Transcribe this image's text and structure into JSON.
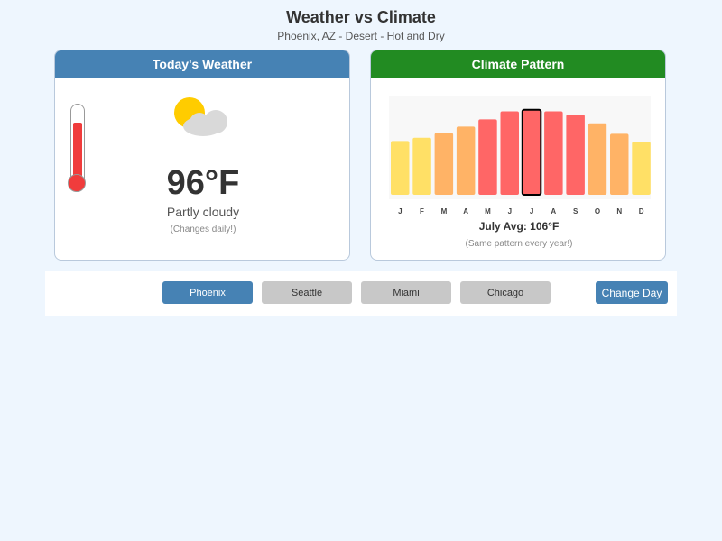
{
  "header": {
    "title": "Weather vs Climate",
    "subtitle": "Phoenix, AZ - Desert - Hot and Dry"
  },
  "weather_card": {
    "title": "Today's Weather",
    "temperature": "96°F",
    "condition": "Partly cloudy",
    "note": "(Changes daily!)",
    "icon": "partly-cloudy-icon",
    "thermometer_level": 0.78
  },
  "climate_card": {
    "title": "Climate Pattern",
    "caption": "July Avg: 106°F",
    "note": "(Same pattern every year!)"
  },
  "chart_data": {
    "type": "bar",
    "categories": [
      "J",
      "F",
      "M",
      "A",
      "M",
      "J",
      "J",
      "A",
      "S",
      "O",
      "N",
      "D"
    ],
    "values": [
      67,
      71,
      77,
      85,
      94,
      104,
      106,
      104,
      100,
      89,
      76,
      66
    ],
    "highlight_index": 6,
    "ylim": [
      0,
      115
    ],
    "grid": false
  },
  "colors": {
    "weather_header": "#4682b4",
    "climate_header": "#228b22",
    "bar_cool": "#ffe066",
    "bar_warm": "#ffb366",
    "bar_hot": "#ff6666",
    "thermometer": "#f03c3c",
    "sun": "#ffcc00",
    "cloud": "#d9d9d9"
  },
  "controls": {
    "cities": [
      {
        "label": "Phoenix",
        "active": true
      },
      {
        "label": "Seattle",
        "active": false
      },
      {
        "label": "Miami",
        "active": false
      },
      {
        "label": "Chicago",
        "active": false
      }
    ],
    "change_day_label": "Change Day"
  }
}
